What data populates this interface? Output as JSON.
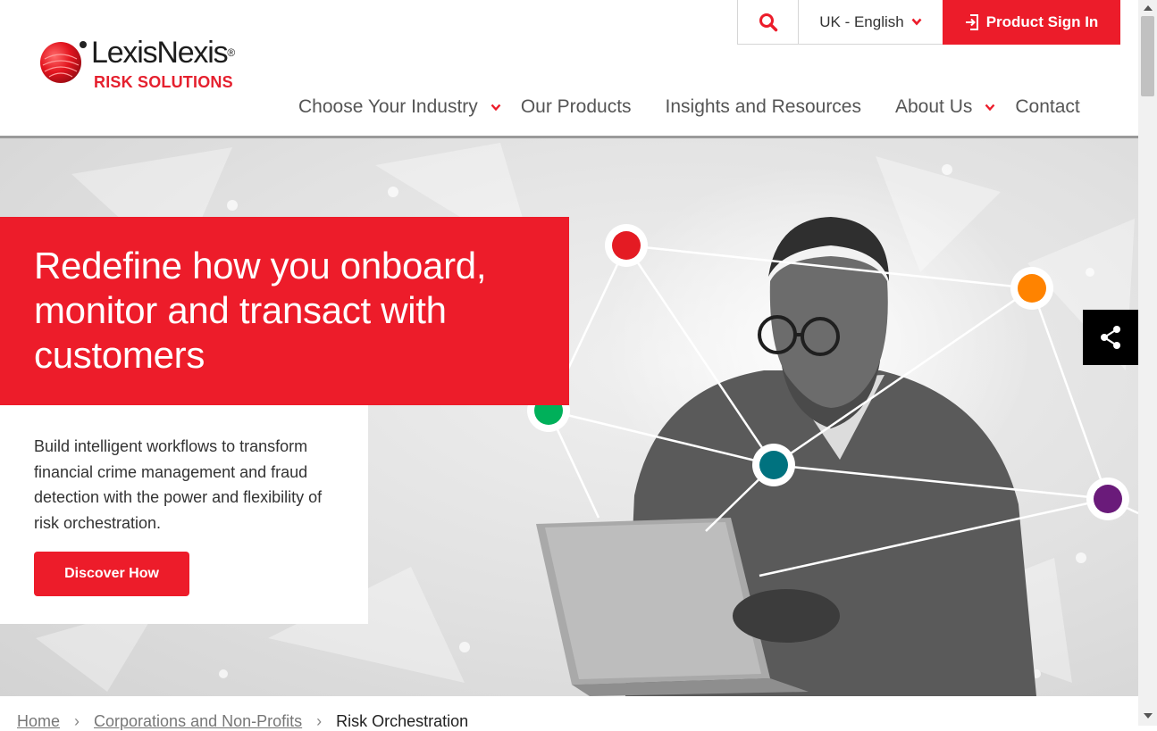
{
  "brand": {
    "name": "LexisNexis",
    "registered": "®",
    "tagline": "RISK SOLUTIONS",
    "accent": "#ed1c2a"
  },
  "utility": {
    "search_icon": "search-icon",
    "language": "UK - English",
    "sign_in": "Product Sign In"
  },
  "nav": {
    "items": [
      {
        "label": "Choose Your Industry",
        "has_dropdown": true
      },
      {
        "label": "Our Products",
        "has_dropdown": false
      },
      {
        "label": "Insights and Resources",
        "has_dropdown": false
      },
      {
        "label": "About Us",
        "has_dropdown": true
      },
      {
        "label": "Contact",
        "has_dropdown": false
      }
    ]
  },
  "hero": {
    "headline": "Redefine how you onboard, monitor and transact with customers",
    "body": "Build intelligent workflows to transform financial crime management and fraud detection with the power and flexibility of risk orchestration.",
    "cta": "Discover How",
    "node_colors": [
      "#e41b23",
      "#ff8300",
      "#00b05a",
      "#00727f",
      "#6a1b7a"
    ]
  },
  "share": {
    "icon": "share-icon"
  },
  "breadcrumb": {
    "items": [
      "Home",
      "Corporations and Non-Profits",
      "Risk Orchestration"
    ],
    "separator": "›"
  }
}
